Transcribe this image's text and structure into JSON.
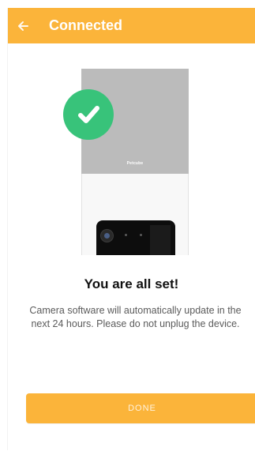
{
  "header": {
    "title": "Connected",
    "back_icon": "arrow-left-icon"
  },
  "device": {
    "brand_text": "Petcube"
  },
  "status": {
    "icon": "check-circle-icon",
    "title": "You are all set!",
    "message": "Camera software will automatically update in the next 24 hours. Please do not unplug the device."
  },
  "actions": {
    "done_label": "DONE"
  },
  "colors": {
    "accent": "#fbb43a",
    "success": "#38c37a"
  }
}
